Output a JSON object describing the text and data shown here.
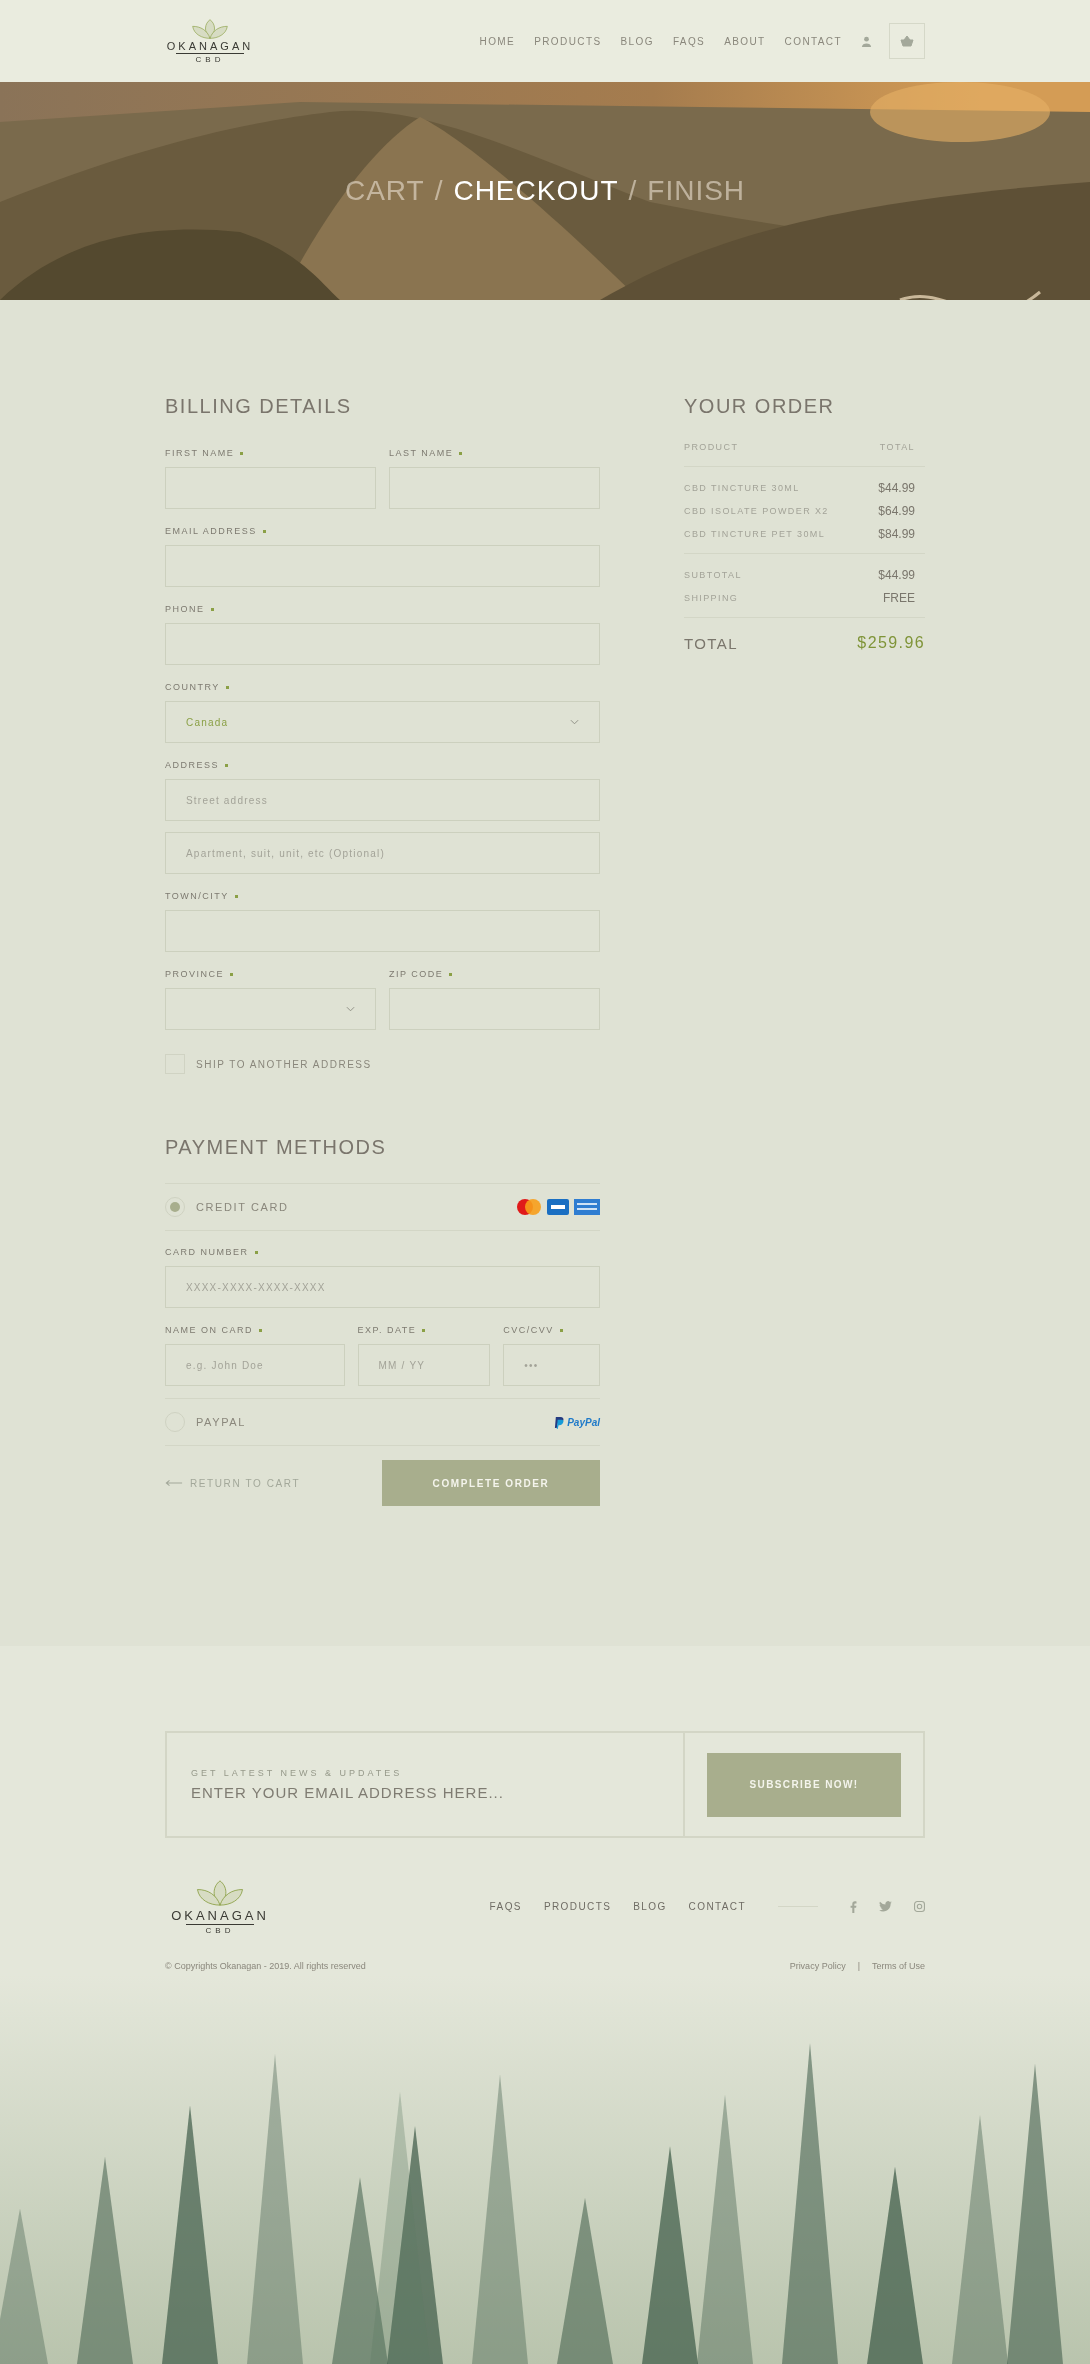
{
  "header": {
    "logo": {
      "name": "OKANAGAN",
      "sub": "CBD"
    },
    "nav": [
      "HOME",
      "PRODUCTS",
      "BLOG",
      "FAQS",
      "ABOUT",
      "CONTACT"
    ]
  },
  "hero": {
    "separator": "/",
    "steps": [
      {
        "label": "CART",
        "selected": false
      },
      {
        "label": "CHECKOUT",
        "selected": true
      },
      {
        "label": "FINISH",
        "selected": false
      }
    ]
  },
  "billing": {
    "title": "BILLING DETAILS",
    "rows": [
      [
        {
          "label": "FIRST NAME",
          "required": true,
          "kind": "text"
        },
        {
          "label": "LAST NAME",
          "required": true,
          "kind": "text"
        }
      ],
      [
        {
          "label": "EMAIL ADDRESS",
          "required": true,
          "kind": "text"
        }
      ],
      [
        {
          "label": "PHONE",
          "required": true,
          "kind": "text"
        }
      ],
      [
        {
          "label": "COUNTRY",
          "required": true,
          "kind": "select",
          "value": "Canada"
        }
      ],
      [
        {
          "label": "ADDRESS",
          "required": true,
          "kind": "text",
          "placeholder": "Street address"
        }
      ],
      [
        {
          "kind": "text",
          "placeholder": "Apartment, suit, unit, etc (Optional)"
        }
      ],
      [
        {
          "label": "TOWN/CITY",
          "required": true,
          "kind": "text"
        }
      ],
      [
        {
          "label": "PROVINCE",
          "required": true,
          "kind": "select"
        },
        {
          "label": "ZIP CODE",
          "required": true,
          "kind": "text"
        }
      ]
    ],
    "ship_other": {
      "label": "SHIP TO ANOTHER ADDRESS",
      "checked": false
    }
  },
  "payment": {
    "title": "PAYMENT METHODS",
    "methods": [
      {
        "label": "CREDIT CARD",
        "selected": true,
        "kind": "card",
        "fields": [
          [
            {
              "label": "CARD NUMBER",
              "required": true,
              "placeholder": "XXXX-XXXX-XXXX-XXXX"
            }
          ],
          [
            {
              "label": "NAME ON CARD",
              "required": true,
              "placeholder": "e.g. John Doe"
            },
            {
              "label": "EXP. DATE",
              "required": true,
              "placeholder": "MM / YY"
            },
            {
              "label": "CVC/CVV",
              "required": true,
              "placeholder": "•••"
            }
          ]
        ]
      },
      {
        "label": "PAYPAL",
        "selected": false,
        "kind": "paypal",
        "logo_text": "PayPal"
      }
    ],
    "back": "RETURN TO CART",
    "submit": "COMPLETE ORDER"
  },
  "order": {
    "title": "YOUR ORDER",
    "columns": [
      "PRODUCT",
      "TOTAL"
    ],
    "items": [
      {
        "name": "CBD TINCTURE 30ML",
        "price": "$44.99"
      },
      {
        "name": "CBD ISOLATE POWDER X2",
        "price": "$64.99"
      },
      {
        "name": "CBD TINCTURE PET 30ML",
        "price": "$84.99"
      }
    ],
    "summary": [
      {
        "label": "SUBTOTAL",
        "value": "$44.99"
      },
      {
        "label": "SHIPPING",
        "value": "FREE"
      }
    ],
    "total": {
      "label": "TOTAL",
      "value": "$259.96"
    }
  },
  "newsletter": {
    "caption": "GET LATEST NEWS & UPDATES",
    "placeholder": "ENTER YOUR EMAIL ADDRESS HERE...",
    "button": "SUBSCRIBE NOW!"
  },
  "footer": {
    "logo": {
      "name": "OKANAGAN",
      "sub": "CBD"
    },
    "nav": [
      "FAQS",
      "PRODUCTS",
      "BLOG",
      "CONTACT"
    ],
    "copyright": "© Copyrights Okanagan - 2019. All rights reserved",
    "links": [
      "Privacy Policy",
      "Terms of Use"
    ],
    "link_separator": "|"
  }
}
